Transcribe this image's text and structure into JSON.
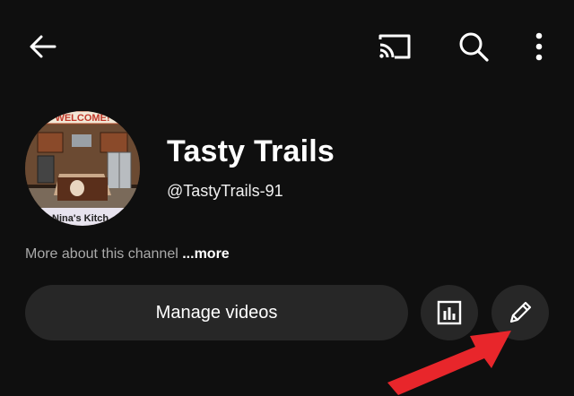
{
  "header": {
    "back_icon": "arrow-left-icon",
    "cast_icon": "cast-icon",
    "search_icon": "search-icon",
    "more_icon": "more-vertical-icon"
  },
  "channel": {
    "name": "Tasty Trails",
    "handle": "@TastyTrails-91",
    "avatar": {
      "banner_top": "WELCOME!",
      "banner_bottom": "Nina's Kitch"
    },
    "about_text": "More about this channel",
    "about_more": "...more"
  },
  "actions": {
    "manage_videos_label": "Manage videos",
    "analytics_icon": "bar-chart-icon",
    "edit_icon": "pencil-icon"
  },
  "annotation": {
    "arrow_color": "#e8262b"
  }
}
